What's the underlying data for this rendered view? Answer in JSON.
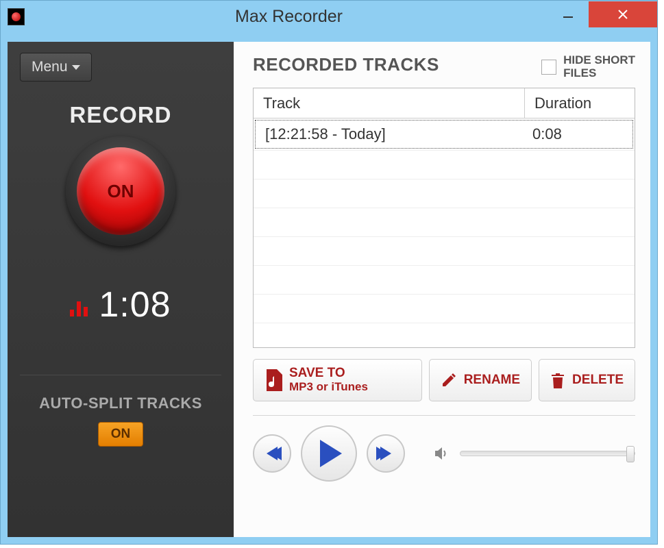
{
  "window": {
    "title": "Max Recorder"
  },
  "left": {
    "menu_label": "Menu",
    "record_label": "RECORD",
    "record_state": "ON",
    "timer": "1:08",
    "auto_split_label": "AUTO-SPLIT TRACKS",
    "auto_split_state": "ON"
  },
  "right": {
    "title": "RECORDED TRACKS",
    "hide_short_label": "HIDE SHORT\nFILES",
    "columns": {
      "track": "Track",
      "duration": "Duration"
    },
    "rows": [
      {
        "track": "[12:21:58 - Today]",
        "duration": "0:08"
      }
    ],
    "actions": {
      "save_line1": "SAVE TO",
      "save_line2": "MP3 or iTunes",
      "rename": "RENAME",
      "delete": "DELETE"
    }
  }
}
